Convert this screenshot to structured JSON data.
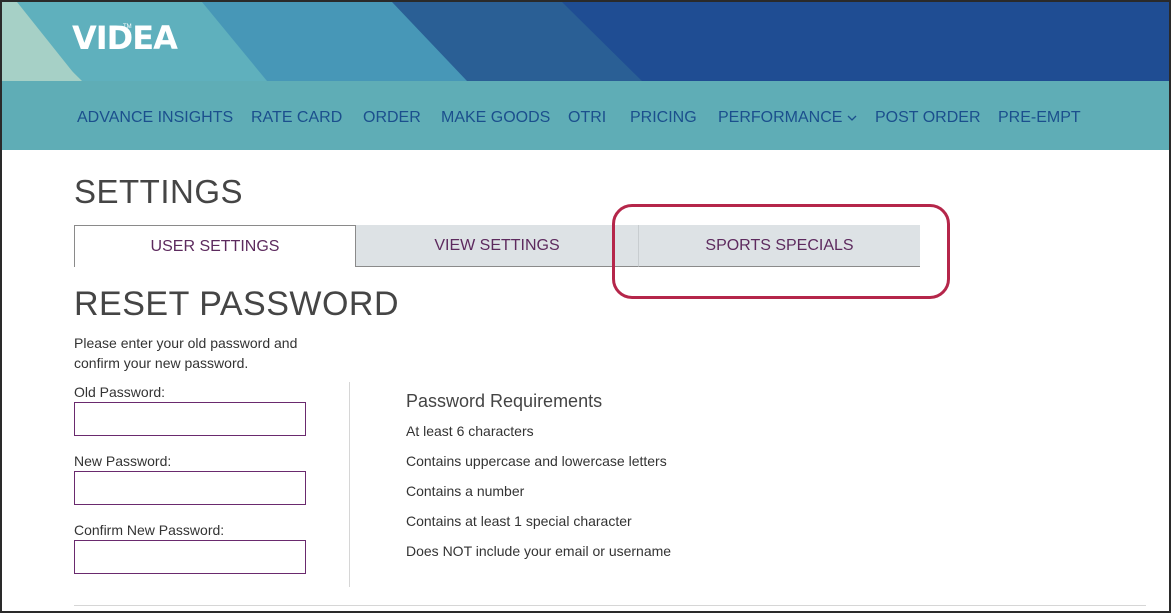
{
  "brand": {
    "logo_text": "VIDEA",
    "trademark": "TM"
  },
  "nav": {
    "items": [
      {
        "label": "ADVANCE INSIGHTS"
      },
      {
        "label": "RATE CARD"
      },
      {
        "label": "ORDER"
      },
      {
        "label": "MAKE GOODS"
      },
      {
        "label": "OTRI"
      },
      {
        "label": "PRICING"
      },
      {
        "label": "PERFORMANCE"
      },
      {
        "label": "POST ORDER"
      },
      {
        "label": "PRE-EMPT"
      }
    ],
    "dropdown_icon": "chevron-down-icon"
  },
  "page": {
    "title": "SETTINGS"
  },
  "tabs": [
    {
      "label": "USER SETTINGS",
      "active": true
    },
    {
      "label": "VIEW SETTINGS",
      "active": false
    },
    {
      "label": "SPORTS SPECIALS",
      "active": false
    }
  ],
  "reset": {
    "title": "RESET PASSWORD",
    "instructions": "Please enter your old password and confirm your new password.",
    "fields": [
      {
        "label": "Old Password:",
        "value": ""
      },
      {
        "label": "New Password:",
        "value": ""
      },
      {
        "label": "Confirm New Password:",
        "value": ""
      }
    ]
  },
  "requirements": {
    "title": "Password Requirements",
    "items": [
      "At least 6 characters",
      "Contains uppercase and lowercase letters",
      "Contains a number",
      "Contains at least 1 special character",
      "Does NOT include your email or username"
    ]
  },
  "colors": {
    "banner_dark": "#1f4d93",
    "nav_bg": "#5fadb6",
    "nav_text": "#1b4f8d",
    "tab_text": "#5d2a5e",
    "highlight": "#b5264a",
    "field_border": "#6a2a6e"
  }
}
